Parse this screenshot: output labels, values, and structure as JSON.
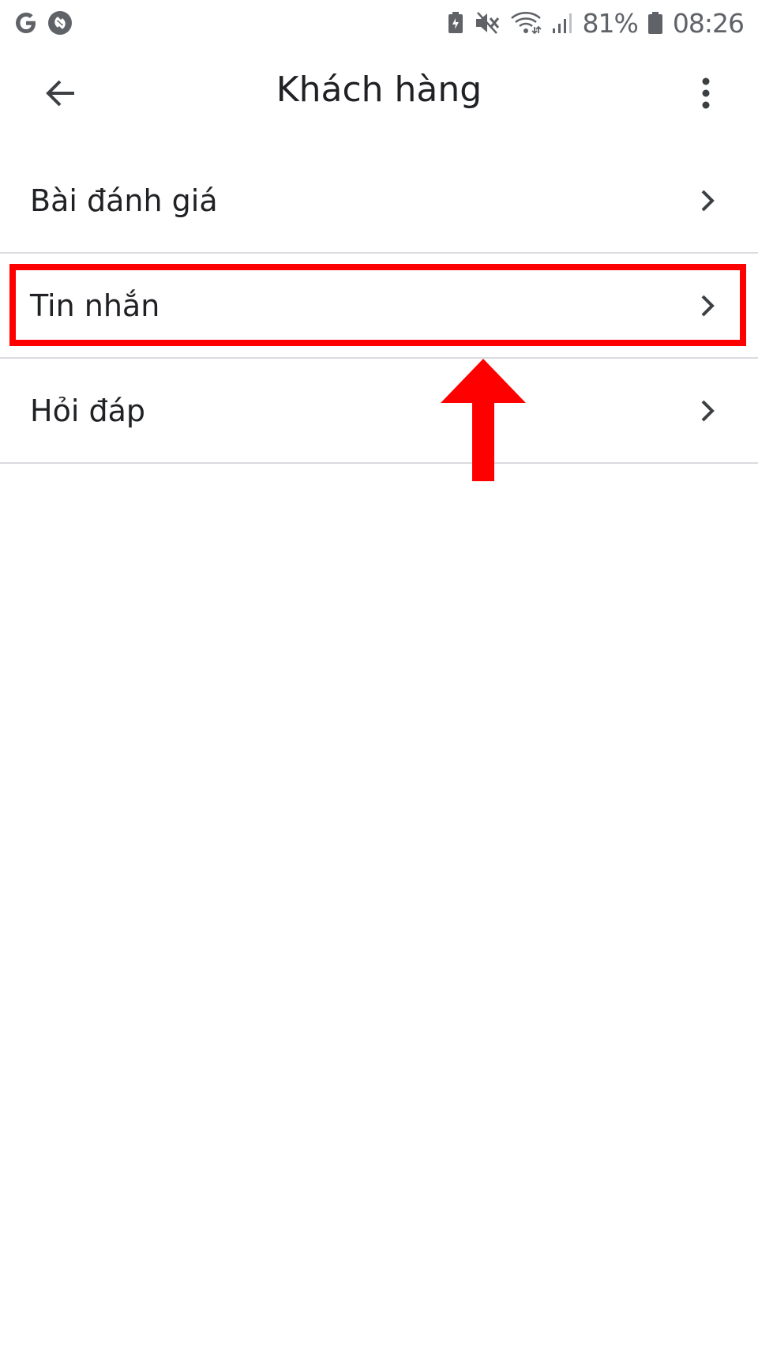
{
  "status_bar": {
    "battery_percent": "81%",
    "time": "08:26",
    "left_icons": [
      "google-g-icon",
      "shazam-icon"
    ],
    "right_icons": [
      "battery-saver-icon",
      "mute-icon",
      "wifi-icon",
      "signal-icon",
      "battery-icon"
    ]
  },
  "app_bar": {
    "title": "Khách hàng",
    "back_icon": "arrow-back-icon",
    "overflow_icon": "more-vert-icon"
  },
  "menu": {
    "items": [
      {
        "label": "Bài đánh giá",
        "icon": "chevron-right-icon"
      },
      {
        "label": "Tin nhắn",
        "icon": "chevron-right-icon",
        "highlighted": true
      },
      {
        "label": "Hỏi đáp",
        "icon": "chevron-right-icon"
      }
    ]
  },
  "annotation": {
    "color": "#ff0000",
    "target_item": "Tin nhắn"
  }
}
